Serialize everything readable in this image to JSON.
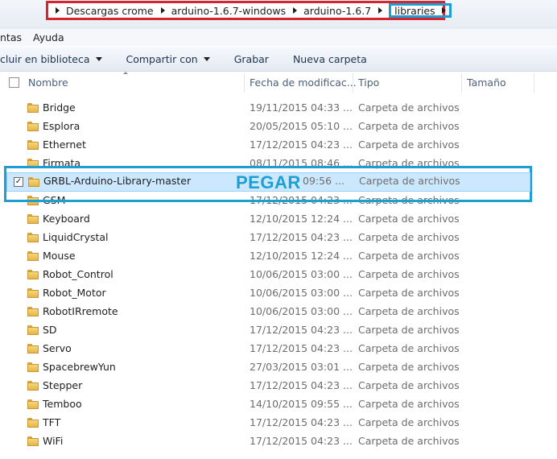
{
  "address_bar": {
    "crumbs": [
      "Descargas crome",
      "arduino-1.6.7-windows",
      "arduino-1.6.7"
    ],
    "current": "libraries"
  },
  "menu": {
    "items": [
      "ntas",
      "Ayuda"
    ]
  },
  "toolbar": {
    "include_library": "cluir en biblioteca",
    "share_with": "Compartir con",
    "burn": "Grabar",
    "new_folder": "Nueva carpeta"
  },
  "columns": {
    "name": "Nombre",
    "date": "Fecha de modificac...",
    "type": "Tipo",
    "size": "Tamaño"
  },
  "files": [
    {
      "name": "Bridge",
      "date": "19/11/2015 04:33 ...",
      "type": "Carpeta de archivos"
    },
    {
      "name": "Esplora",
      "date": "20/05/2015 05:10 ...",
      "type": "Carpeta de archivos"
    },
    {
      "name": "Ethernet",
      "date": "17/12/2015 04:23 ...",
      "type": "Carpeta de archivos"
    },
    {
      "name": "Firmata",
      "date": "08/11/2015 08:46 ...",
      "type": "Carpeta de archivos"
    },
    {
      "name": "GSM",
      "date": "17/12/2015 04:23 ...",
      "type": "Carpeta de archivos"
    },
    {
      "name": "Keyboard",
      "date": "12/10/2015 12:24 ...",
      "type": "Carpeta de archivos"
    },
    {
      "name": "LiquidCrystal",
      "date": "17/12/2015 04:23 ...",
      "type": "Carpeta de archivos"
    },
    {
      "name": "Mouse",
      "date": "12/10/2015 12:24 ...",
      "type": "Carpeta de archivos"
    },
    {
      "name": "Robot_Control",
      "date": "10/06/2015 03:00 ...",
      "type": "Carpeta de archivos"
    },
    {
      "name": "Robot_Motor",
      "date": "10/06/2015 03:00 ...",
      "type": "Carpeta de archivos"
    },
    {
      "name": "RobotIRremote",
      "date": "10/06/2015 03:00 ...",
      "type": "Carpeta de archivos"
    },
    {
      "name": "SD",
      "date": "17/12/2015 04:23 ...",
      "type": "Carpeta de archivos"
    },
    {
      "name": "Servo",
      "date": "17/12/2015 04:23 ...",
      "type": "Carpeta de archivos"
    },
    {
      "name": "SpacebrewYun",
      "date": "27/03/2015 03:01 ...",
      "type": "Carpeta de archivos"
    },
    {
      "name": "Stepper",
      "date": "17/12/2015 04:23 ...",
      "type": "Carpeta de archivos"
    },
    {
      "name": "Temboo",
      "date": "14/10/2015 09:55 ...",
      "type": "Carpeta de archivos"
    },
    {
      "name": "TFT",
      "date": "17/12/2015 04:23 ...",
      "type": "Carpeta de archivos"
    },
    {
      "name": "WiFi",
      "date": "17/12/2015 04:23 ...",
      "type": "Carpeta de archivos"
    }
  ],
  "selected": {
    "name": "GRBL-Arduino-Library-master",
    "date": "09:56 ...",
    "type": "Carpeta de archivos",
    "checked": true
  },
  "annotation": {
    "label": "PEGAR",
    "color": "#1d9fd4"
  },
  "colors": {
    "highlight_red": "#d7252f",
    "highlight_blue": "#1d9fd4",
    "selection": "#cce8ff"
  }
}
